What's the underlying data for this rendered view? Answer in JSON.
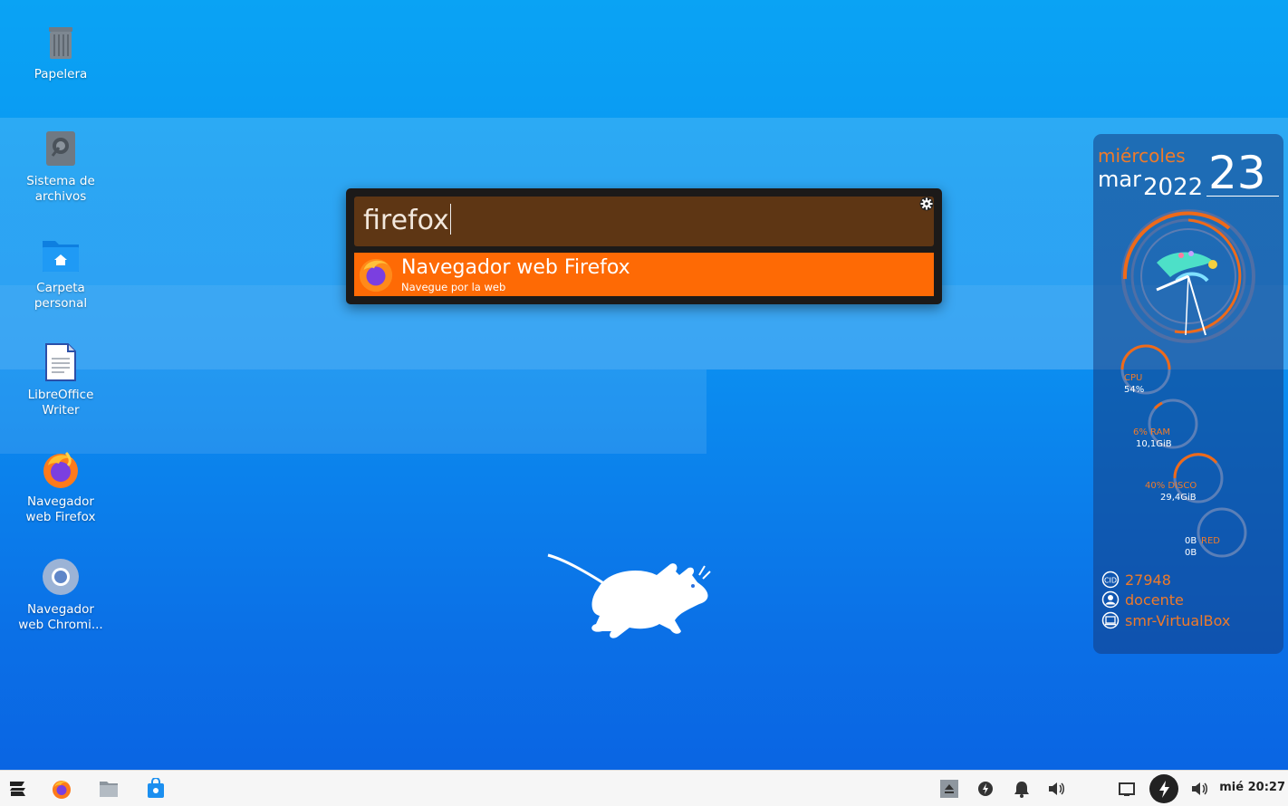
{
  "desktop": {
    "icons": [
      {
        "label": "Papelera",
        "icon": "trash-icon"
      },
      {
        "label": "Sistema de\narchivos",
        "icon": "drive-icon"
      },
      {
        "label": "Carpeta\npersonal",
        "icon": "home-folder-icon"
      },
      {
        "label": "LibreOffice\nWriter",
        "icon": "document-icon"
      },
      {
        "label": "Navegador\nweb Firefox",
        "icon": "firefox-icon"
      },
      {
        "label": "Navegador\nweb Chromi...",
        "icon": "chromium-icon"
      }
    ]
  },
  "launcher": {
    "query": "firefox",
    "settings_icon": "gear-icon",
    "result": {
      "title": "Navegador web Firefox",
      "subtitle": "Navegue por la web",
      "icon": "firefox-icon"
    }
  },
  "conky": {
    "weekday": "miércoles",
    "month": "mar",
    "year": "2022",
    "day": "23",
    "meters": [
      {
        "label": "CPU",
        "value": "54%",
        "level": 0.54
      },
      {
        "label": "6% RAM",
        "value": "10,1GiB",
        "level": 0.06
      },
      {
        "label": "40% DISCO",
        "value": "29,4GiB",
        "level": 0.4
      },
      {
        "label": "RED",
        "value_top": "0B",
        "value_bottom": "0B",
        "level": 0
      }
    ],
    "info": [
      {
        "icon": "id-icon",
        "text": "27948"
      },
      {
        "icon": "user-icon",
        "text": "docente"
      },
      {
        "icon": "laptop-icon",
        "text": "smr-VirtualBox"
      }
    ],
    "colors": {
      "accent": "#ee7a2a",
      "ring": "#5a7fb8"
    }
  },
  "taskbar": {
    "left": [
      "zorin-menu-icon",
      "firefox-icon",
      "files-icon",
      "software-store-icon"
    ],
    "tray": [
      "eject-icon",
      "update-icon",
      "bell-icon",
      "volume-icon",
      "screen-icon",
      "power-mode-icon",
      "volume-icon"
    ],
    "clock": "mié 20:27"
  },
  "colors": {
    "launcher_result": "#fe6a05",
    "launcher_input": "#5e3614"
  }
}
